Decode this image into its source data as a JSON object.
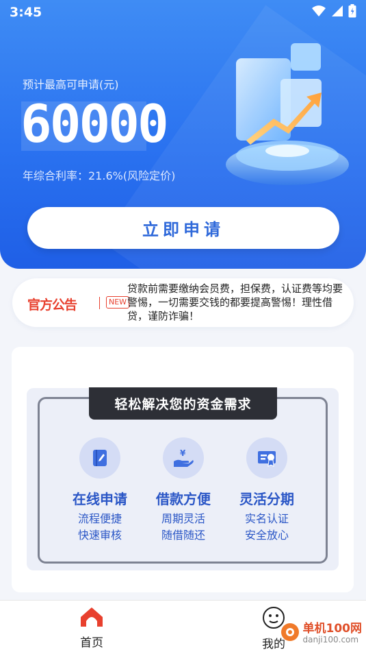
{
  "status_bar": {
    "time": "3:45",
    "icons": [
      "wifi-icon",
      "signal-icon",
      "battery-icon"
    ]
  },
  "hero": {
    "label": "预计最高可申请(元)",
    "amount": "60000",
    "rate": "年综合利率：21.6%(风险定价)",
    "apply_label": "立即申请"
  },
  "notice": {
    "brand": "官方公告",
    "badge": "NEW",
    "text": "贷款前需要缴纳会员费，担保费，认证费等均要警惕，一切需要交钱的都要提高警惕！理性借贷，谨防诈骗！"
  },
  "features": {
    "heading": "轻松解决您的资金需求",
    "items": [
      {
        "title": "在线申请",
        "line1": "流程便捷",
        "line2": "快速审核",
        "icon": "book-icon"
      },
      {
        "title": "借款方便",
        "line1": "周期灵活",
        "line2": "随借随还",
        "icon": "money-hand-icon"
      },
      {
        "title": "灵活分期",
        "line1": "实名认证",
        "line2": "安全放心",
        "icon": "certificate-icon"
      }
    ]
  },
  "tabbar": {
    "items": [
      {
        "label": "首页",
        "icon": "home-icon",
        "active": true
      },
      {
        "label": "我的",
        "icon": "profile-face-icon",
        "active": false
      }
    ]
  },
  "watermark": {
    "name": "单机100网",
    "url": "danji100.com"
  },
  "colors": {
    "primary": "#2a72f0",
    "accent": "#2360d8",
    "notice": "#e8402e"
  }
}
